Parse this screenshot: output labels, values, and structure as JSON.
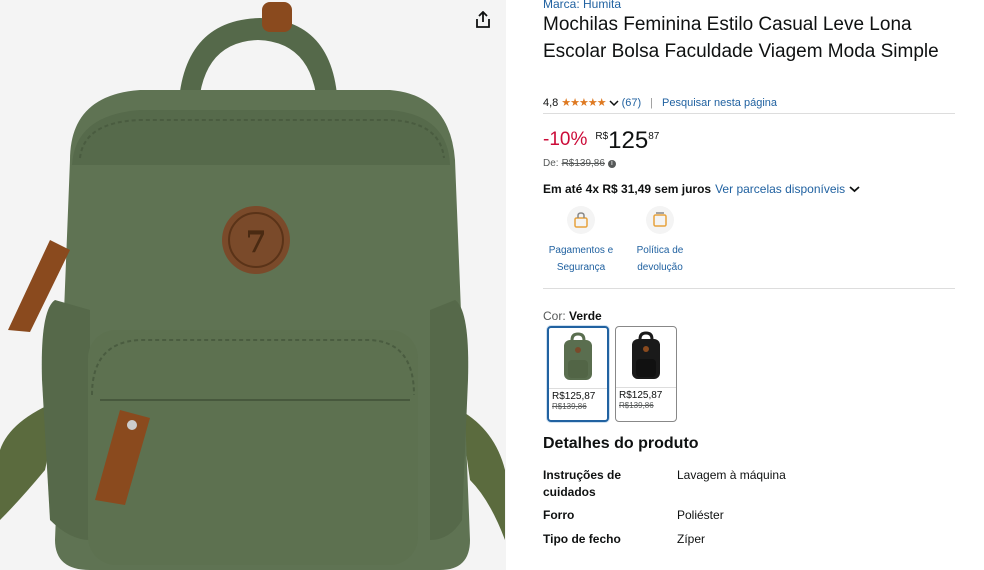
{
  "product": {
    "brand": "Marca: Humita",
    "title": "Mochilas Feminina Estilo Casual Leve Lona Escolar Bolsa Faculdade Viagem Moda Simple",
    "rating_value": "4,8",
    "rating_stars": "★★★★★",
    "rating_count": "(67)",
    "search_page": "Pesquisar nesta página"
  },
  "price": {
    "discount": "-10%",
    "currency": "R$",
    "whole": "125",
    "cents": "87",
    "list_label": "De:",
    "list_price": "R$139,86",
    "installments": "Em até 4x R$ 31,49 sem juros",
    "installments_link": "Ver parcelas disponíveis"
  },
  "features": [
    {
      "label": "Pagamentos e Segurança",
      "icon": "secure-payment-icon"
    },
    {
      "label": "Política de devolução",
      "icon": "return-policy-icon"
    }
  ],
  "color": {
    "label": "Cor:",
    "selected": "Verde",
    "options": [
      {
        "name": "green-backpack",
        "price": "R$125,87",
        "old": "R$139,86",
        "color": "#5a6e4f"
      },
      {
        "name": "black-backpack",
        "price": "R$125,87",
        "old": "R$139,86",
        "color": "#1a1a1a"
      }
    ]
  },
  "details": {
    "heading": "Detalhes do produto",
    "rows": [
      {
        "key": "Instruções de cuidados",
        "value": "Lavagem à máquina"
      },
      {
        "key": "Forro",
        "value": "Poliéster"
      },
      {
        "key": "Tipo de fecho",
        "value": "Zíper"
      }
    ]
  },
  "colors": {
    "link": "#2162a1",
    "discount": "#cc0c39",
    "star": "#de7921",
    "bag_green": "#5c7050"
  }
}
